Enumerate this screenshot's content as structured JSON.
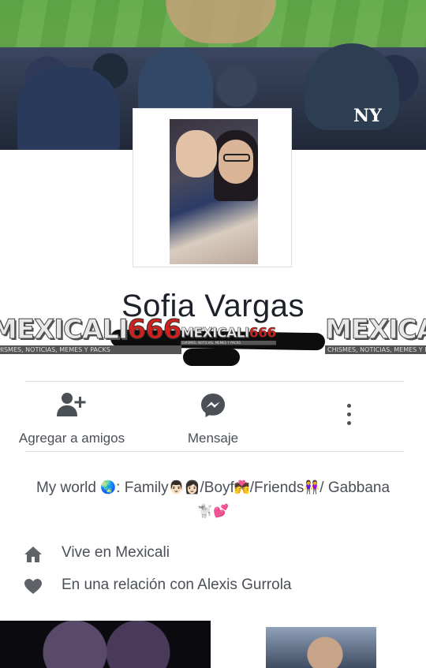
{
  "profile": {
    "name": "Sofia Vargas"
  },
  "cover": {
    "cap_logo": "NY"
  },
  "watermark": {
    "brand": "MEXICALI",
    "number": "666",
    "tagline": "CHISMES, NOTICIAS, MEMES Y PACKS"
  },
  "actions": {
    "add_friend_label": "Agregar a amigos",
    "message_label": "Mensaje",
    "add_friend_icon": "add-friend-icon",
    "message_icon": "messenger-icon",
    "more_icon": "more-vertical-icon"
  },
  "bio": {
    "part1": "My world ",
    "globe": "🌏",
    "part2": ": Family",
    "family_emoji": "👨🏻👩🏻",
    "part3": "/Boyf",
    "boyf_emoji": "💏",
    "part4": "/Friends",
    "friends_emoji": "👭",
    "part5": "/ Gabbana",
    "gabbana_emoji": "🐩💕"
  },
  "info": {
    "lives_in": "Vive en Mexicali",
    "relationship": "En una relación con Alexis Gurrola",
    "home_icon": "home-icon",
    "heart_icon": "heart-icon"
  },
  "colors": {
    "text": "#4b4f56",
    "name": "#1d2129",
    "divider": "#dadde1",
    "watermark_red": "#d0201e"
  }
}
